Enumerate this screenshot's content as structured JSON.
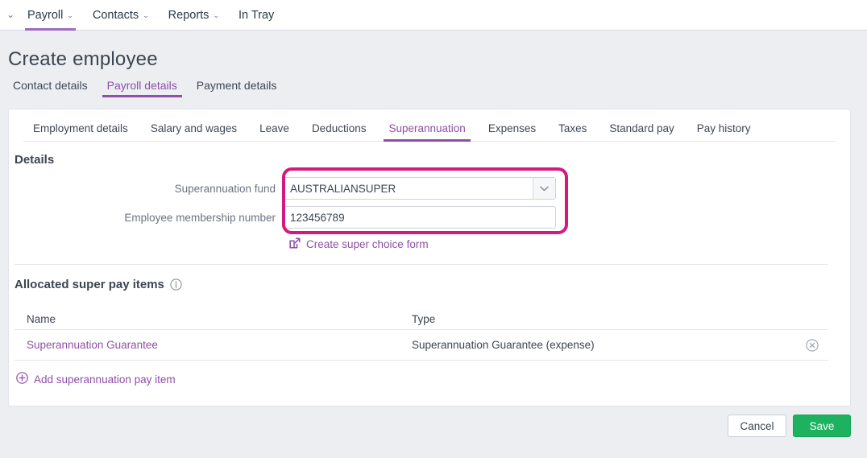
{
  "topnav": {
    "edge_icon": "chevron-down-icon",
    "items": [
      {
        "label": "Payroll",
        "caret": "⌄",
        "active": true
      },
      {
        "label": "Contacts",
        "caret": "⌄",
        "active": false
      },
      {
        "label": "Reports",
        "caret": "⌄",
        "active": false
      },
      {
        "label": "In Tray",
        "caret": "",
        "active": false
      }
    ]
  },
  "page": {
    "title": "Create employee",
    "tabs": [
      {
        "label": "Contact details",
        "active": false
      },
      {
        "label": "Payroll details",
        "active": true
      },
      {
        "label": "Payment details",
        "active": false
      }
    ]
  },
  "subtabs": [
    {
      "label": "Employment details",
      "active": false
    },
    {
      "label": "Salary and wages",
      "active": false
    },
    {
      "label": "Leave",
      "active": false
    },
    {
      "label": "Deductions",
      "active": false
    },
    {
      "label": "Superannuation",
      "active": true
    },
    {
      "label": "Expenses",
      "active": false
    },
    {
      "label": "Taxes",
      "active": false
    },
    {
      "label": "Standard pay",
      "active": false
    },
    {
      "label": "Pay history",
      "active": false
    }
  ],
  "details": {
    "heading": "Details",
    "super_fund": {
      "label": "Superannuation fund",
      "value": "AUSTRALIANSUPER",
      "dropdown_icon": "chevron-down-icon"
    },
    "membership_number": {
      "label": "Employee membership number",
      "value": "123456789"
    },
    "choice_form_link": {
      "label": "Create super choice form",
      "icon": "external-link-icon"
    },
    "highlight_color": "#d6197e"
  },
  "allocated": {
    "heading": "Allocated super pay items",
    "info_icon": "info-circle-icon",
    "columns": [
      "Name",
      "Type"
    ],
    "rows": [
      {
        "name": "Superannuation Guarantee",
        "type": "Superannuation Guarantee (expense)",
        "remove_icon": "remove-circle-icon"
      }
    ],
    "add_link": {
      "label": "Add superannuation pay item",
      "icon": "plus-circle-icon"
    }
  },
  "footer": {
    "cancel_label": "Cancel",
    "save_label": "Save",
    "save_color": "#1cb25f"
  }
}
